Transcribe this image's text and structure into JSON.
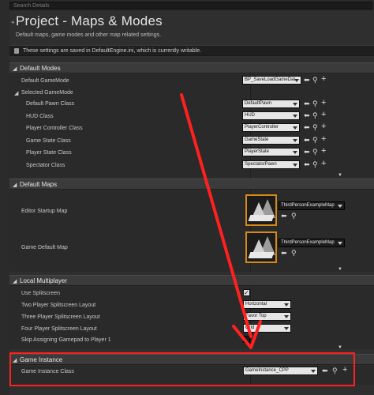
{
  "search": {
    "placeholder": "Search Details"
  },
  "header": {
    "title": "Project - Maps & Modes",
    "subtitle": "Default maps, game modes and other map related settings.",
    "notice": "These settings are saved in DefaultEngine.ini, which is currently writable."
  },
  "default_modes": {
    "title": "Default Modes",
    "default_gamemode_label": "Default GameMode",
    "default_gamemode_value": "BP_SaveLoadGameDat",
    "selected_gamemode_label": "Selected GameMode",
    "rows": [
      {
        "label": "Default Pawn Class",
        "value": "DefaultPawn"
      },
      {
        "label": "HUD Class",
        "value": "HUD"
      },
      {
        "label": "Player Controller Class",
        "value": "PlayerController"
      },
      {
        "label": "Game State Class",
        "value": "GameState"
      },
      {
        "label": "Player State Class",
        "value": "PlayerState"
      },
      {
        "label": "Spectator Class",
        "value": "SpectatorPawn"
      }
    ]
  },
  "default_maps": {
    "title": "Default Maps",
    "editor_startup_label": "Editor Startup Map",
    "editor_startup_value": "ThirdPersonExampleMap",
    "game_default_label": "Game Default Map",
    "game_default_value": "ThirdPersonExampleMap"
  },
  "local_multiplayer": {
    "title": "Local Multiplayer",
    "use_splitscreen_label": "Use Splitscreen",
    "use_splitscreen_checked": true,
    "two_player_label": "Two Player Splitscreen Layout",
    "two_player_value": "Horizontal",
    "three_player_label": "Three Player Splitscreen Layout",
    "three_player_value": "Favor Top",
    "four_player_label": "Four Player Splitscreen Layout",
    "four_player_value": "Grid",
    "skip_gamepad_label": "Skip Assigning Gamepad to Player 1"
  },
  "game_instance": {
    "title": "Game Instance",
    "class_label": "Game Instance Class",
    "class_value": "GameInstance_CPP"
  },
  "colors": {
    "annotation_red": "#ff2020",
    "thumbnail_border": "#d48a14"
  }
}
